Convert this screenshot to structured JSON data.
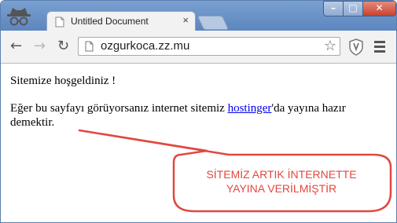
{
  "browser": {
    "tab_title": "Untitled Document",
    "tab_close": "×",
    "url": "ozgurkoca.zz.mu",
    "window_controls": {
      "minimize": "–",
      "maximize": "□",
      "close": "✕"
    },
    "nav": {
      "back": "←",
      "forward": "→",
      "reload": "↻"
    },
    "bookmark_star": "☆"
  },
  "page": {
    "welcome": "Sitemize hoşgeldiniz !",
    "para_before": "Eğer bu sayfayı görüyorsanız internet sitemiz ",
    "link": "hostinger",
    "para_after": "'da yayına hazır demektir."
  },
  "annotation": {
    "line1": "SİTEMİZ ARTIK İNTERNETTE",
    "line2": "YAYINA VERİLMİŞTİR",
    "color": "#e0483f"
  }
}
